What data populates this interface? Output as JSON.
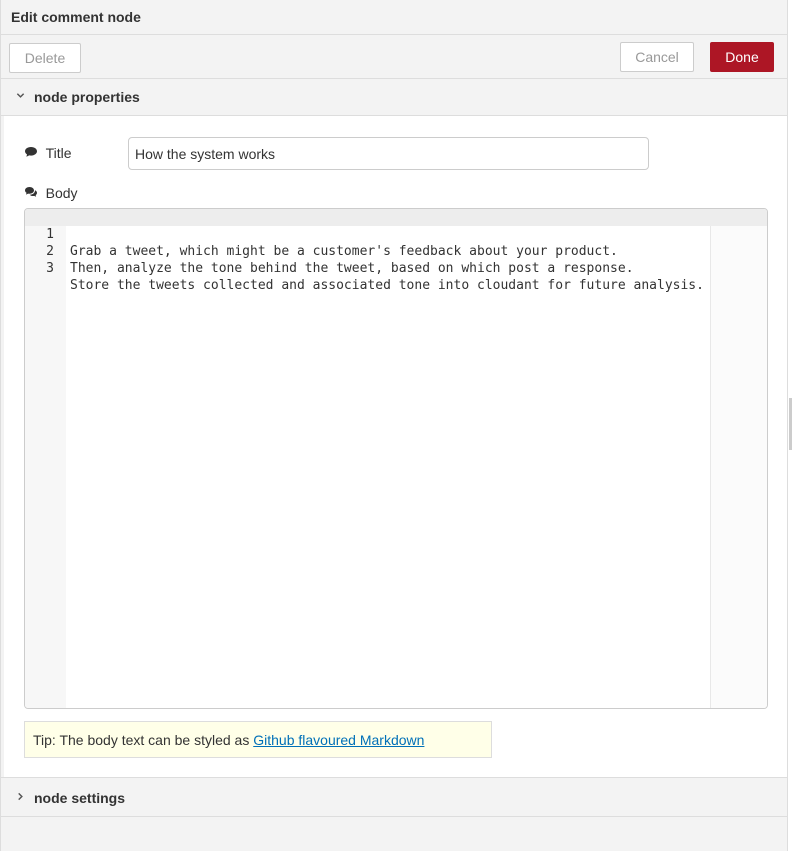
{
  "tray": {
    "title": "Edit comment node"
  },
  "toolbar": {
    "delete_label": "Delete",
    "cancel_label": "Cancel",
    "done_label": "Done"
  },
  "sections": {
    "properties_label": "node properties",
    "settings_label": "node settings"
  },
  "form": {
    "title_label": "Title",
    "title_value": "How the system works",
    "body_label": "Body",
    "body_lines": [
      {
        "number": "1",
        "text": "Grab a tweet, which might be a customer's feedback about your product."
      },
      {
        "number": "2",
        "text": "Then, analyze the tone behind the tweet, based on which post a response."
      },
      {
        "number": "3",
        "text": "Store the tweets collected and associated tone into cloudant for future analysis."
      }
    ]
  },
  "tip": {
    "prefix": "Tip: The body text can be styled as ",
    "link_text": "Github flavoured Markdown"
  },
  "icons": {
    "title_icon": "comment-icon",
    "body_icon": "comments-icon",
    "properties_chevron": "chevron-down-icon",
    "settings_chevron": "chevron-right-icon"
  },
  "colors": {
    "done_button": "#ad1625",
    "link": "#0070b8",
    "tip_background": "#ffffe8"
  }
}
